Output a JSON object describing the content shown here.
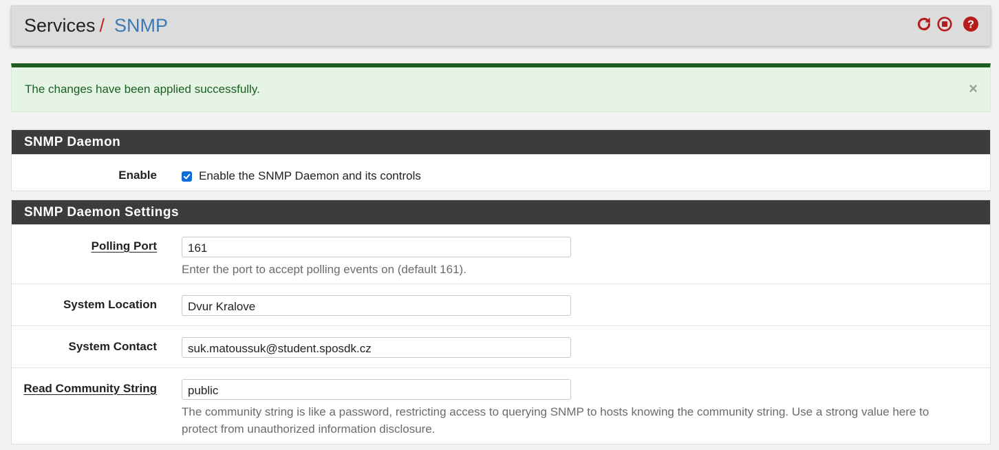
{
  "breadcrumb": {
    "parent": "Services",
    "separator": "/",
    "current": "SNMP"
  },
  "header_icons": [
    {
      "name": "restart-icon",
      "color": "#b71c1c"
    },
    {
      "name": "stop-icon",
      "color": "#b71c1c"
    },
    {
      "name": "help-icon",
      "color": "#b71c1c"
    }
  ],
  "alert": {
    "message": "The changes have been applied successfully.",
    "close": "×"
  },
  "daemon_panel": {
    "title": "SNMP Daemon",
    "enable_label": "Enable",
    "enable_checkbox_text": "Enable the SNMP Daemon and its controls",
    "enabled": true
  },
  "settings_panel": {
    "title": "SNMP Daemon Settings",
    "polling_port": {
      "label": "Polling Port",
      "value": "161",
      "help": "Enter the port to accept polling events on (default 161)."
    },
    "system_location": {
      "label": "System Location",
      "value": "Dvur Kralove"
    },
    "system_contact": {
      "label": "System Contact",
      "value": "suk.matoussuk@student.sposdk.cz"
    },
    "read_community": {
      "label": "Read Community String",
      "value": "public",
      "help": "The community string is like a password, restricting access to querying SNMP to hosts knowing the community string. Use a strong value here to protect from unauthorized information disclosure."
    }
  },
  "colors": {
    "accent_red": "#b71c1c",
    "link_blue": "#3c78b5",
    "success_green": "#1d5e20",
    "panel_heading": "#3c3c3c",
    "checkbox_blue": "#0b6dd6"
  }
}
